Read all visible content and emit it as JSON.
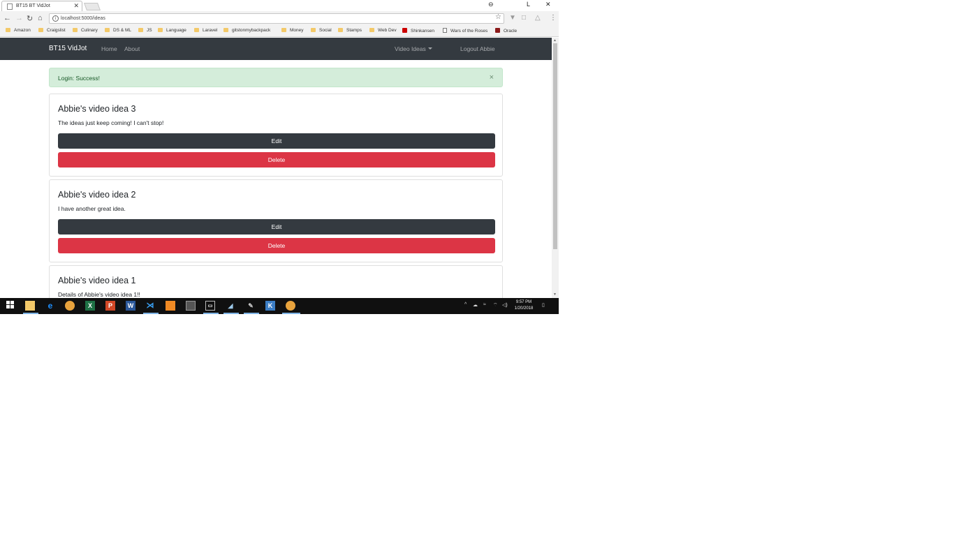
{
  "browser": {
    "tab_title": "BT15 BT VidJot",
    "url": "localhost:5000/ideas",
    "bookmarks": [
      "Amazon",
      "Craigslist",
      "Culinary",
      "DS & ML",
      "JS",
      "Language",
      "Laravel",
      "gitstonmybackpack",
      "Money",
      "Social",
      "Stamps",
      "Web Dev",
      "Shinkansen",
      "Wars of the Roses",
      "Oracle"
    ]
  },
  "navbar": {
    "brand": "BT15 VidJot",
    "home": "Home",
    "about": "About",
    "video_ideas": "Video Ideas",
    "logout": "Logout Abbie"
  },
  "alert": {
    "message": "Login: Success!",
    "close": "×"
  },
  "ideas": [
    {
      "title": "Abbie's video idea 3",
      "details": "The ideas just keep coming! I can't stop!",
      "edit": "Edit",
      "delete": "Delete"
    },
    {
      "title": "Abbie's video idea 2",
      "details": "I have another great idea.",
      "edit": "Edit",
      "delete": "Delete"
    },
    {
      "title": "Abbie's video idea 1",
      "details": "Details of Abbie's video idea 1!!"
    }
  ],
  "taskbar": {
    "time": "9:57 PM",
    "date": "1/20/2018"
  },
  "colors": {
    "navbar_bg": "#343a40",
    "alert_bg": "#d4edda",
    "danger": "#dc3545"
  }
}
